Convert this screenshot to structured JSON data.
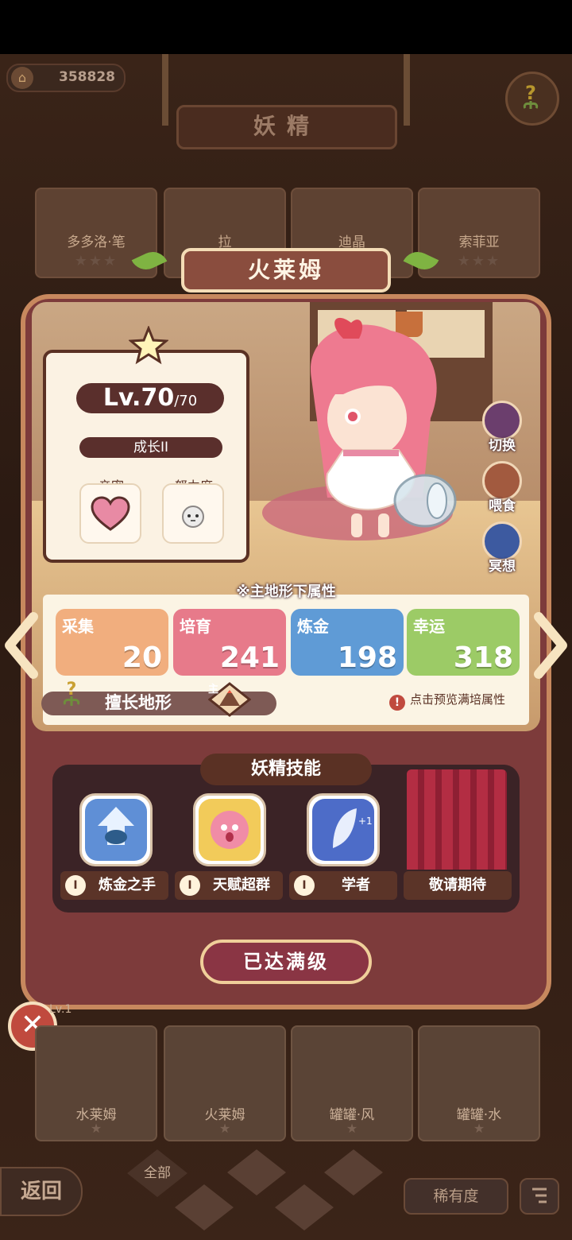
{
  "header": {
    "coins": "358828",
    "title": "妖精"
  },
  "background_cards": [
    {
      "name": "多多洛·笔",
      "stars": "★★★"
    },
    {
      "name": "拉",
      "stars": ""
    },
    {
      "name": "迪晶",
      "stars": ""
    },
    {
      "name": "索菲亚",
      "stars": "★★★"
    }
  ],
  "fairy": {
    "name": "火莱姆",
    "level": "Lv.70",
    "level_max": "/70",
    "growth": "成长II",
    "intimacy_label": "亲密",
    "effort_label": "努力度"
  },
  "actions": {
    "switch": "切换",
    "feed": "喂食",
    "meditate": "冥想"
  },
  "attributes": {
    "heading": "※主地形下属性",
    "items": [
      {
        "name": "采集",
        "value": "20",
        "color": "#f1ae7e"
      },
      {
        "name": "培育",
        "value": "241",
        "color": "#e77a8a"
      },
      {
        "name": "炼金",
        "value": "198",
        "color": "#5f9bd6"
      },
      {
        "name": "幸运",
        "value": "318",
        "color": "#9ccb66"
      }
    ],
    "terrain_label": "擅长地形",
    "terrain_tag": "主",
    "preview_hint": "点击预览满培属性"
  },
  "skills": {
    "title": "妖精技能",
    "items": [
      {
        "roman": "I",
        "name": "炼金之手"
      },
      {
        "roman": "I",
        "name": "天赋超群"
      },
      {
        "roman": "I",
        "name": "学者"
      }
    ],
    "coming_soon": "敬请期待"
  },
  "max_level_button": "已达满级",
  "bottom_cards": [
    {
      "name": "水莱姆",
      "stars": "★",
      "level": "Lv.1"
    },
    {
      "name": "火莱姆",
      "stars": "★"
    },
    {
      "name": "罐罐·风",
      "stars": "★"
    },
    {
      "name": "罐罐·水",
      "stars": "★"
    }
  ],
  "footer": {
    "back": "返回",
    "tab_all": "全部",
    "rarity": "稀有度"
  },
  "colors": {
    "panel_red": "#7d3b3b",
    "accent_gold": "#f0cf9a",
    "card_bg": "#fbf2e3"
  }
}
